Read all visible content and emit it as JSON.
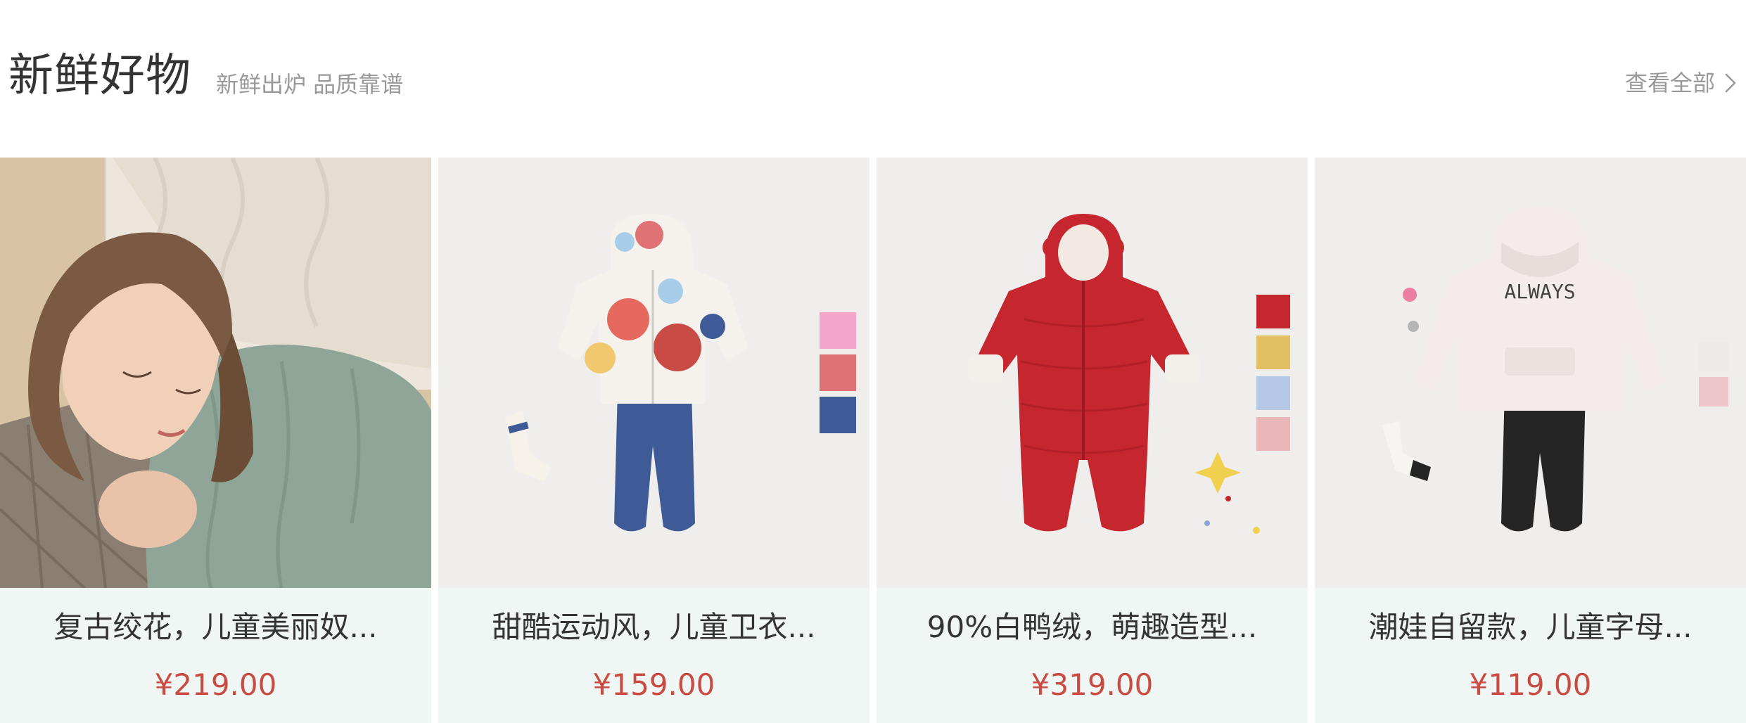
{
  "section": {
    "title": "新鲜好物",
    "subtitle": "新鲜出炉 品质靠谱",
    "view_all_label": "查看全部",
    "view_all_icon": "chevron-right-icon"
  },
  "colors": {
    "title": "#333333",
    "muted": "#999999",
    "price": "#c94b41",
    "card_footer_bg": "#f0f6f3",
    "image_bg": "#f0eeed"
  },
  "products": [
    {
      "name": "复古绞花，儿童美丽奴...",
      "price": "¥219.00",
      "image": "girl-sleeping-in-green-knit-sweater"
    },
    {
      "name": "甜酷运动风，儿童卫衣...",
      "price": "¥159.00",
      "image": "patterned-hoodie-and-blue-pants-set",
      "swatches": [
        "#f2a7c9",
        "#e07275",
        "#3e5a97"
      ]
    },
    {
      "name": "90%白鸭绒，萌趣造型...",
      "price": "¥319.00",
      "image": "red-down-snowsuit-with-ears",
      "swatches": [
        "#c6262e",
        "#e3bf63",
        "#b5c8e6",
        "#eab6b7"
      ]
    },
    {
      "name": "潮娃自留款，儿童字母...",
      "price": "¥119.00",
      "image": "cream-always-hoodie-and-black-pants",
      "swatches": [
        "#efeaea",
        "#ecc6cb"
      ]
    }
  ]
}
